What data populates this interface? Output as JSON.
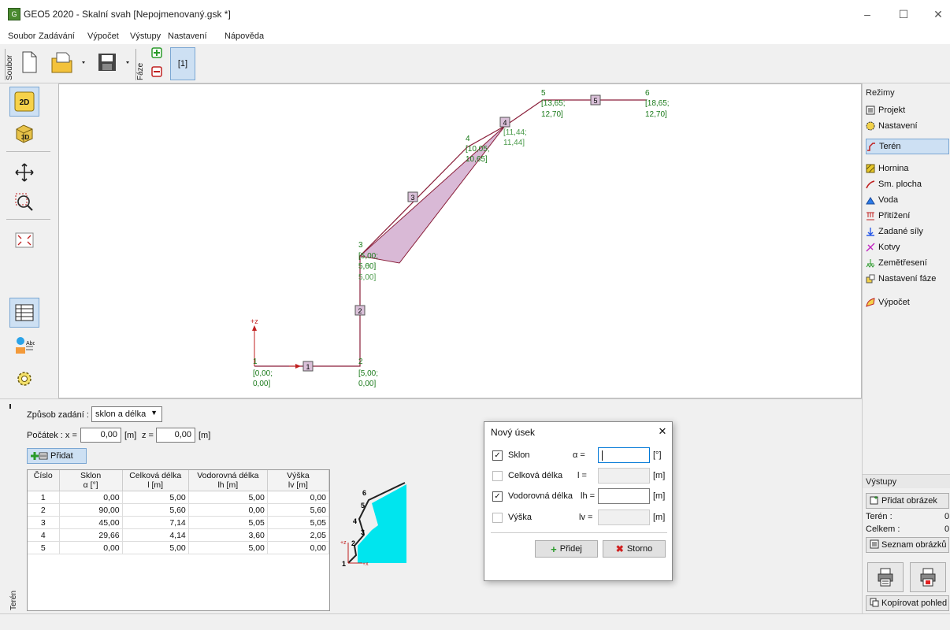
{
  "window": {
    "title": "GEO5 2020 - Skalní svah [Nepojmenovaný.gsk *]",
    "app_icon": "GEO5 app icon",
    "minimize": "–",
    "maximize": "☐",
    "close": "✕"
  },
  "menu": [
    "Soubor",
    "Zadávání",
    "Výpočet",
    "Výstupy",
    "Nastavení",
    "Nápověda"
  ],
  "toolbar": {
    "file_group_label": "Soubor",
    "phase_group_label": "Fáze",
    "phase_tab": "[1]"
  },
  "canvas": {
    "points": [
      {
        "num": "1",
        "coord_x": "[0,00;",
        "coord_z": "0,00]"
      },
      {
        "num": "2",
        "coord_x": "[5,00;",
        "coord_z": "0,00]"
      },
      {
        "num": "3",
        "coord_x": "[5,00;",
        "coord_z": "5,60]"
      },
      {
        "num": "4",
        "coord_x": "[10,05;",
        "coord_z": "10,65]"
      },
      {
        "num": "5",
        "coord_x": "[13,65;",
        "coord_z": "12,70]"
      },
      {
        "num": "6",
        "coord_x": "[18,65;",
        "coord_z": "12,70]"
      }
    ],
    "new_point": {
      "coord_x": "[11,44;",
      "coord_z": "11,44]"
    },
    "extra_labels": [
      "5,00;",
      "5,00]"
    ],
    "segments": [
      "1",
      "2",
      "3",
      "4",
      "5"
    ],
    "axis_z": "+z",
    "axis_x": "+x"
  },
  "left_tools": [
    "2D",
    "3D",
    "pan",
    "zoom-window",
    "zoom-fit",
    "table",
    "labels",
    "settings"
  ],
  "right_panel": {
    "modes_header": "Režimy",
    "modes": [
      "Projekt",
      "Nastavení",
      "Terén",
      "Hornina",
      "Sm. plocha",
      "Voda",
      "Přitížení",
      "Zadané síly",
      "Kotvy",
      "Zemětřesení",
      "Nastavení fáze",
      "Výpočet"
    ],
    "active_mode": "Terén",
    "outputs_header": "Výstupy",
    "add_picture": "Přidat obrázek",
    "teren_label": "Terén :",
    "teren_count": "0",
    "celkem_label": "Celkem :",
    "celkem_count": "0",
    "list_pictures": "Seznam obrázků",
    "copy_view": "Kopírovat pohled"
  },
  "bottom": {
    "side_label": "Terén",
    "input_mode_label": "Způsob zadání :",
    "input_mode_value": "sklon a délka",
    "origin_label": "Počátek : x =",
    "origin_x": "0,00",
    "unit_m": "[m]",
    "z_label": "z =",
    "origin_z": "0,00",
    "add_button": "Přidat",
    "columns": [
      {
        "l1": "Číslo",
        "l2": ""
      },
      {
        "l1": "Sklon",
        "l2": "α [°]"
      },
      {
        "l1": "Celková délka",
        "l2": "l [m]"
      },
      {
        "l1": "Vodorovná délka",
        "l2": "lh [m]"
      },
      {
        "l1": "Výška",
        "l2": "lv [m]"
      }
    ],
    "rows": [
      [
        "1",
        "0,00",
        "5,00",
        "5,00",
        "0,00"
      ],
      [
        "2",
        "90,00",
        "5,60",
        "0,00",
        "5,60"
      ],
      [
        "3",
        "45,00",
        "7,14",
        "5,05",
        "5,05"
      ],
      [
        "4",
        "29,66",
        "4,14",
        "3,60",
        "2,05"
      ],
      [
        "5",
        "0,00",
        "5,00",
        "5,00",
        "0,00"
      ]
    ],
    "preview_labels": [
      "6",
      "5",
      "4",
      "3",
      "2",
      "1"
    ],
    "preview_axis_z": "+z",
    "preview_axis_x": "+x"
  },
  "dialog": {
    "title": "Nový úsek",
    "close": "✕",
    "rows": [
      {
        "label": "Sklon",
        "symbol": "α =",
        "unit": "[°]",
        "checked": true,
        "enabled": true
      },
      {
        "label": "Celková délka",
        "symbol": "l =",
        "unit": "[m]",
        "checked": false,
        "enabled": false
      },
      {
        "label": "Vodorovná délka",
        "symbol": "lh =",
        "unit": "[m]",
        "checked": true,
        "enabled": true
      },
      {
        "label": "Výška",
        "symbol": "lv =",
        "unit": "[m]",
        "checked": false,
        "enabled": false
      }
    ],
    "add_button": "Přidej",
    "cancel_button": "Storno"
  },
  "colors": {
    "terrain_line": "#8a1f3a",
    "coord_text": "#1a7a1a",
    "preview_fill": "#00e5ee",
    "active_bg": "#cde0f3"
  }
}
